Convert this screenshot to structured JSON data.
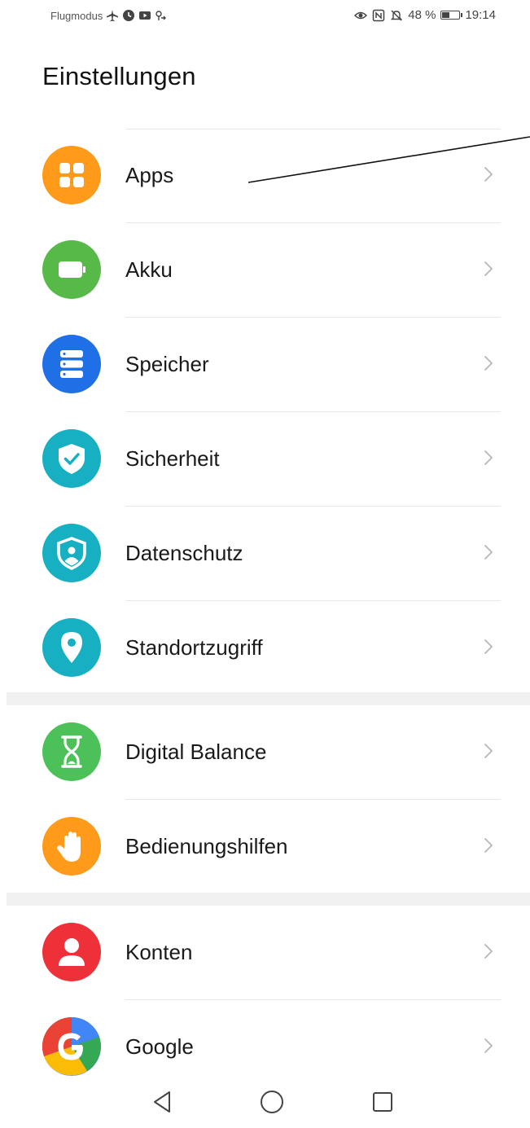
{
  "status_bar": {
    "left_text": "Flugmodus",
    "battery_text": "48 %",
    "time": "19:14",
    "icons_left": [
      "airplane-icon",
      "clock-icon",
      "media-icon",
      "link-icon"
    ],
    "icons_right": [
      "eye-icon",
      "nfc-icon",
      "mute-icon",
      "battery-icon"
    ],
    "battery_level": 0.48
  },
  "header": {
    "title": "Einstellungen"
  },
  "settings": [
    {
      "id": "apps",
      "label": "Apps",
      "icon": "apps-icon",
      "color": "#FF9A1A"
    },
    {
      "id": "akku",
      "label": "Akku",
      "icon": "battery-icon",
      "color": "#57B947"
    },
    {
      "id": "speicher",
      "label": "Speicher",
      "icon": "storage-icon",
      "color": "#1F6FE6"
    },
    {
      "id": "sicherheit",
      "label": "Sicherheit",
      "icon": "shield-check-icon",
      "color": "#16B0C2"
    },
    {
      "id": "datenschutz",
      "label": "Datenschutz",
      "icon": "privacy-shield-icon",
      "color": "#16B0C2"
    },
    {
      "id": "standortzugriff",
      "label": "Standortzugriff",
      "icon": "location-pin-icon",
      "color": "#16B0C2"
    },
    {
      "id": "digital-balance",
      "label": "Digital Balance",
      "icon": "hourglass-icon",
      "color": "#4CC159"
    },
    {
      "id": "bedienungshilfen",
      "label": "Bedienungshilfen",
      "icon": "hand-icon",
      "color": "#FF9A1A"
    },
    {
      "id": "konten",
      "label": "Konten",
      "icon": "person-icon",
      "color": "#EE3038"
    },
    {
      "id": "google",
      "label": "Google",
      "icon": "google-icon",
      "color": "#4285F4"
    }
  ],
  "nav": {
    "icons": [
      "back-icon",
      "home-icon",
      "recents-icon"
    ]
  }
}
